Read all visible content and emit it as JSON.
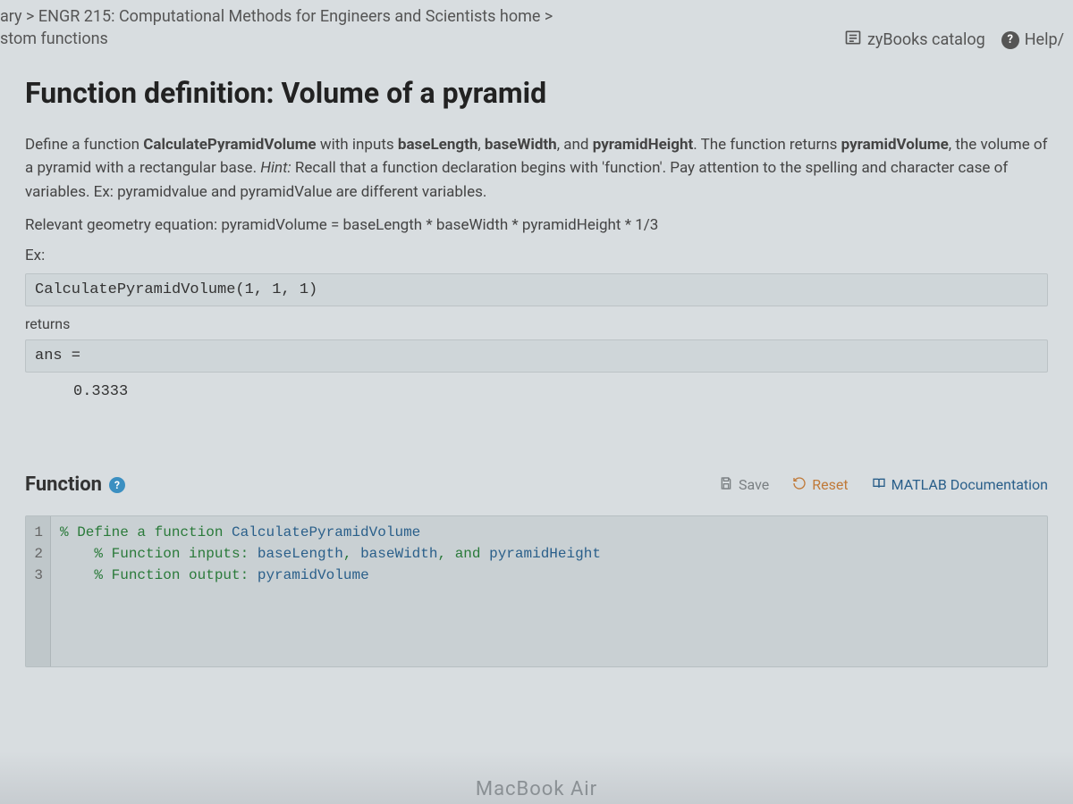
{
  "breadcrumb": {
    "line1": "ary > ENGR 215: Computational Methods for Engineers and Scientists home >",
    "line2": "stom functions"
  },
  "topright": {
    "catalog": "zyBooks catalog",
    "help": "Help/"
  },
  "title": "Function definition: Volume of a pyramid",
  "prompt": {
    "p1a": "Define a function ",
    "fn": "CalculatePyramidVolume",
    "p1b": " with inputs ",
    "in1": "baseLength",
    "p1c": ", ",
    "in2": "baseWidth",
    "p1d": ", and ",
    "in3": "pyramidHeight",
    "p1e": ". The function returns ",
    "out": "pyramidVolume",
    "p1f": ", the volume of a pyramid with a rectangular base. ",
    "hint_label": "Hint:",
    "hint_text": " Recall that a function declaration begins with 'function'. Pay attention to the spelling and character case of variables. Ex: pyramidvalue and pyramidValue are different variables."
  },
  "relevant_eq": "Relevant geometry equation: pyramidVolume = baseLength * baseWidth * pyramidHeight * 1/3",
  "ex_label": "Ex:",
  "ex_code": "CalculatePyramidVolume(1, 1, 1)",
  "returns_label": "returns",
  "ans_label": "ans =",
  "ans_value": "0.3333",
  "editor": {
    "title": "Function",
    "save": "Save",
    "reset": "Reset",
    "docs": "MATLAB Documentation",
    "lines": {
      "n1": "1",
      "n2": "2",
      "n3": "3",
      "l1a": "% Define a function ",
      "l1b": "CalculatePyramidVolume",
      "l2a": "    % Function inputs: ",
      "l2b": "baseLength",
      "l2c": ", ",
      "l2d": "baseWidth",
      "l2e": ", and ",
      "l2f": "pyramidHeight",
      "l3a": "    % Function output: ",
      "l3b": "pyramidVolume"
    }
  },
  "device_label": "MacBook Air"
}
